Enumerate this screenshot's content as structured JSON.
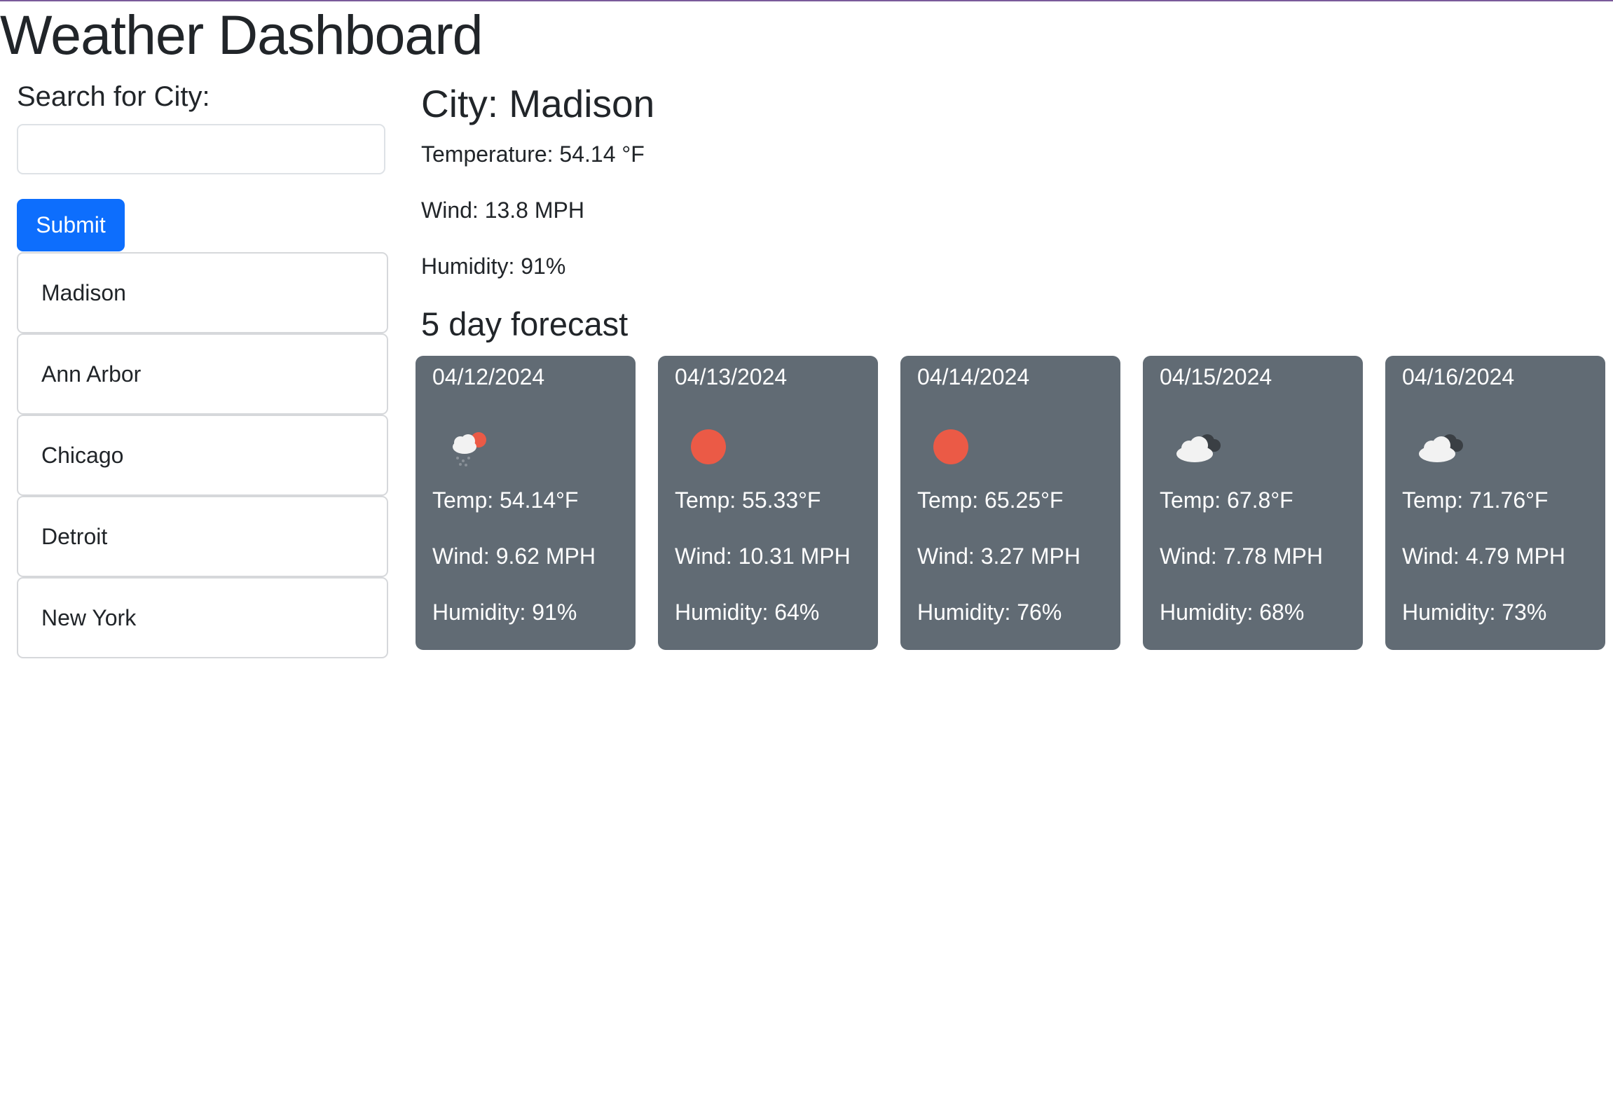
{
  "app": {
    "title": "Weather Dashboard"
  },
  "search": {
    "label": "Search for City:",
    "value": "",
    "placeholder": "",
    "submit_label": "Submit"
  },
  "history": [
    {
      "label": "Madison"
    },
    {
      "label": "Ann Arbor"
    },
    {
      "label": "Chicago"
    },
    {
      "label": "Detroit"
    },
    {
      "label": "New York"
    }
  ],
  "current": {
    "city_heading": "City: Madison",
    "temperature": "Temperature: 54.14 °F",
    "wind": "Wind: 13.8 MPH",
    "humidity": "Humidity: 91%"
  },
  "forecast": {
    "heading": "5 day forecast",
    "card_color": "#616b74",
    "days": [
      {
        "date": "04/12/2024",
        "icon": "rain-sun-icon",
        "temp": "Temp: 54.14°F",
        "wind": "Wind: 9.62 MPH",
        "humidity": "Humidity: 91%"
      },
      {
        "date": "04/13/2024",
        "icon": "sun-icon",
        "temp": "Temp: 55.33°F",
        "wind": "Wind: 10.31 MPH",
        "humidity": "Humidity: 64%"
      },
      {
        "date": "04/14/2024",
        "icon": "sun-icon",
        "temp": "Temp: 65.25°F",
        "wind": "Wind: 3.27 MPH",
        "humidity": "Humidity: 76%"
      },
      {
        "date": "04/15/2024",
        "icon": "broken-clouds-icon",
        "temp": "Temp: 67.8°F",
        "wind": "Wind: 7.78 MPH",
        "humidity": "Humidity: 68%"
      },
      {
        "date": "04/16/2024",
        "icon": "broken-clouds-icon",
        "temp": "Temp: 71.76°F",
        "wind": "Wind: 4.79 MPH",
        "humidity": "Humidity: 73%"
      }
    ]
  },
  "colors": {
    "accent": "#0d6efd",
    "sun": "#eb5a46",
    "text": "#212529"
  }
}
